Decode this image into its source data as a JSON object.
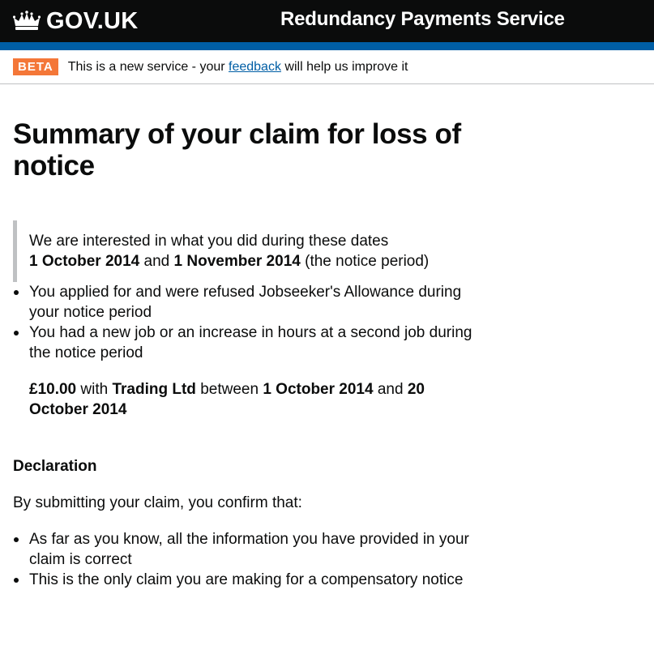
{
  "header": {
    "logo_text": "GOV.UK",
    "service_name": "Redundancy Payments Service",
    "logo_icon": "crown-icon"
  },
  "phase_banner": {
    "tag": "BETA",
    "text_before": "This is a new service - your ",
    "link_text": "feedback",
    "text_after": " will help us improve it"
  },
  "page_title": "Summary of your claim for loss of notice",
  "notice_inset": {
    "line1": "We are interested in what you did during these dates",
    "start_date": "1 October 2014",
    "and_word": " and ",
    "end_date": "1 November 2014",
    "suffix": " (the notice period)"
  },
  "answers": {
    "jsa": "You applied for and were refused Jobseeker's Allowance during your notice period",
    "new_job": "You had a new job or an increase in hours at a second job during the notice period",
    "job_detail": {
      "amount": "£10.00",
      "with_word": " with ",
      "employer": "Trading Ltd",
      "between_word": " between ",
      "start_date": "1 October 2014",
      "and_word": " and ",
      "end_date": "20 October 2014"
    }
  },
  "declaration": {
    "heading": "Declaration",
    "intro": "By submitting your claim, you confirm that:",
    "items": [
      "As far as you know, all the information you have provided in your claim is correct",
      "This is the only claim you are making for a compensatory notice"
    ]
  },
  "colors": {
    "header_bg": "#0b0c0c",
    "brand_bar": "#005ea5",
    "beta_tag": "#f47738",
    "link": "#005ea5",
    "inset_border": "#bfc1c3"
  }
}
